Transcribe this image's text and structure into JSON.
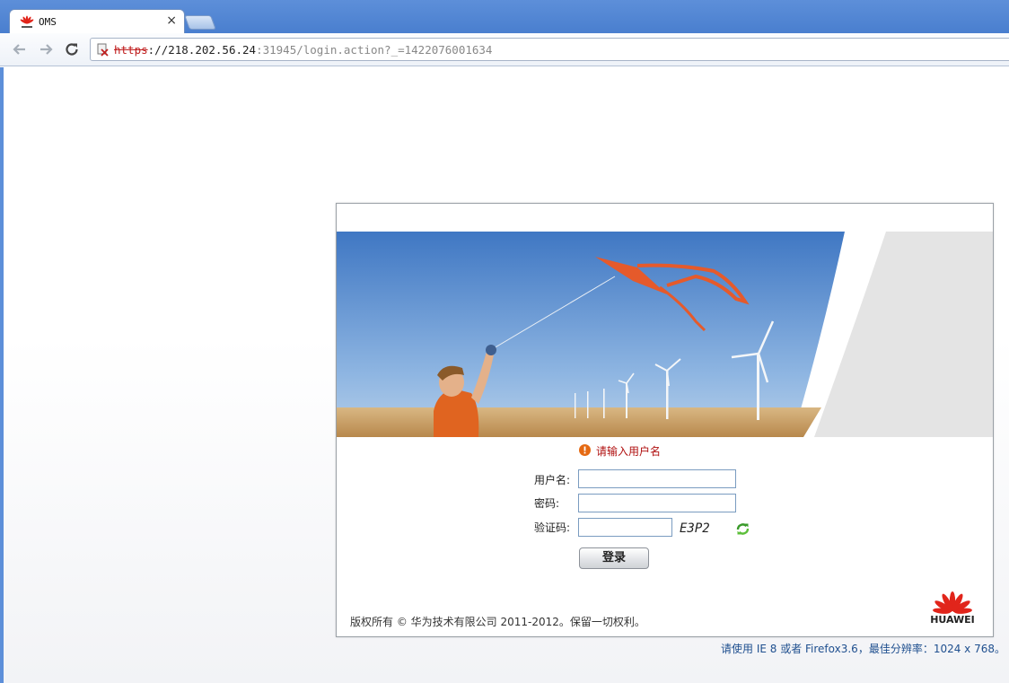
{
  "browser": {
    "tab_title": "OMS",
    "tab_close": "×",
    "url_scheme": "https",
    "url_host": "://218.202.56.24",
    "url_rest": ":31945/login.action?_=1422076001634",
    "back_icon": "arrow-left-icon",
    "forward_icon": "arrow-right-icon",
    "reload_icon": "reload-icon"
  },
  "login": {
    "error_message": "请输入用户名",
    "username_label": "用户名:",
    "password_label": "密码:",
    "captcha_label": "验证码:",
    "username_value": "",
    "password_value": "",
    "captcha_value": "",
    "captcha_text": "E3P2",
    "login_button": "登录"
  },
  "footer": {
    "copyright": "版权所有 © 华为技术有限公司 2011-2012。保留一切权利。",
    "brand": "HUAWEI",
    "resolution_note": "请使用 IE 8 或者 Firefox3.6，最佳分辨率：1024 x 768。"
  },
  "colors": {
    "chrome_blue": "#4a7fcf",
    "error_red": "#b01010",
    "note_blue": "#1f4f8f",
    "huawei_red": "#e1251b"
  }
}
